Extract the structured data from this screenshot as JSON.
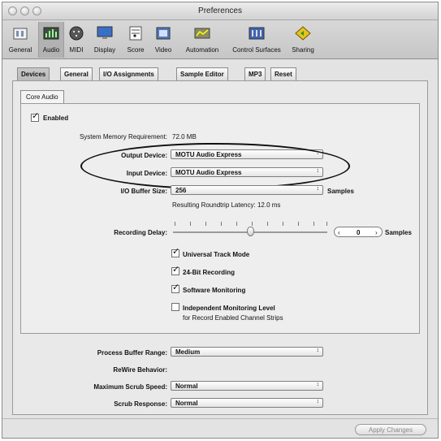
{
  "window": {
    "title": "Preferences"
  },
  "toolbar": {
    "items": [
      {
        "label": "General",
        "icon": "general-icon"
      },
      {
        "label": "Audio",
        "icon": "audio-icon",
        "selected": true
      },
      {
        "label": "MIDI",
        "icon": "midi-icon"
      },
      {
        "label": "Display",
        "icon": "display-icon"
      },
      {
        "label": "Score",
        "icon": "score-icon"
      },
      {
        "label": "Video",
        "icon": "video-icon"
      },
      {
        "label": "Automation",
        "icon": "automation-icon"
      },
      {
        "label": "Control Surfaces",
        "icon": "control-surfaces-icon"
      },
      {
        "label": "Sharing",
        "icon": "sharing-icon"
      }
    ]
  },
  "tabs": [
    "Devices",
    "General",
    "I/O Assignments",
    "Sample Editor",
    "MP3",
    "Reset"
  ],
  "subtab": "Core Audio",
  "core_audio": {
    "enabled_label": "Enabled",
    "enabled_checked": true,
    "memory_label": "System Memory Requirement:",
    "memory_value": "72.0 MB",
    "output_label": "Output Device:",
    "output_value": "MOTU Audio Express",
    "input_label": "Input Device:",
    "input_value": "MOTU Audio Express",
    "buffer_label": "I/O Buffer Size:",
    "buffer_value": "256",
    "buffer_unit": "Samples",
    "latency_text": "Resulting Roundtrip Latency: 12.0 ms",
    "recording_delay_label": "Recording Delay:",
    "recording_delay_value": "0",
    "recording_delay_unit": "Samples",
    "recording_delay_slider": 0.5,
    "options": [
      {
        "label": "Universal Track Mode",
        "checked": true
      },
      {
        "label": "24-Bit Recording",
        "checked": true
      },
      {
        "label": "Software Monitoring",
        "checked": true
      },
      {
        "label": "Independent Monitoring Level",
        "checked": false
      }
    ],
    "independent_sublabel": "for Record Enabled Channel Strips"
  },
  "bottom": {
    "process_label": "Process Buffer Range:",
    "process_value": "Medium",
    "rewire_label": "ReWire Behavior:",
    "scrub_speed_label": "Maximum Scrub Speed:",
    "scrub_speed_value": "Normal",
    "scrub_response_label": "Scrub Response:",
    "scrub_response_value": "Normal"
  },
  "apply_label": "Apply Changes",
  "glyphs": {
    "check": "✓",
    "updown": "↕"
  }
}
